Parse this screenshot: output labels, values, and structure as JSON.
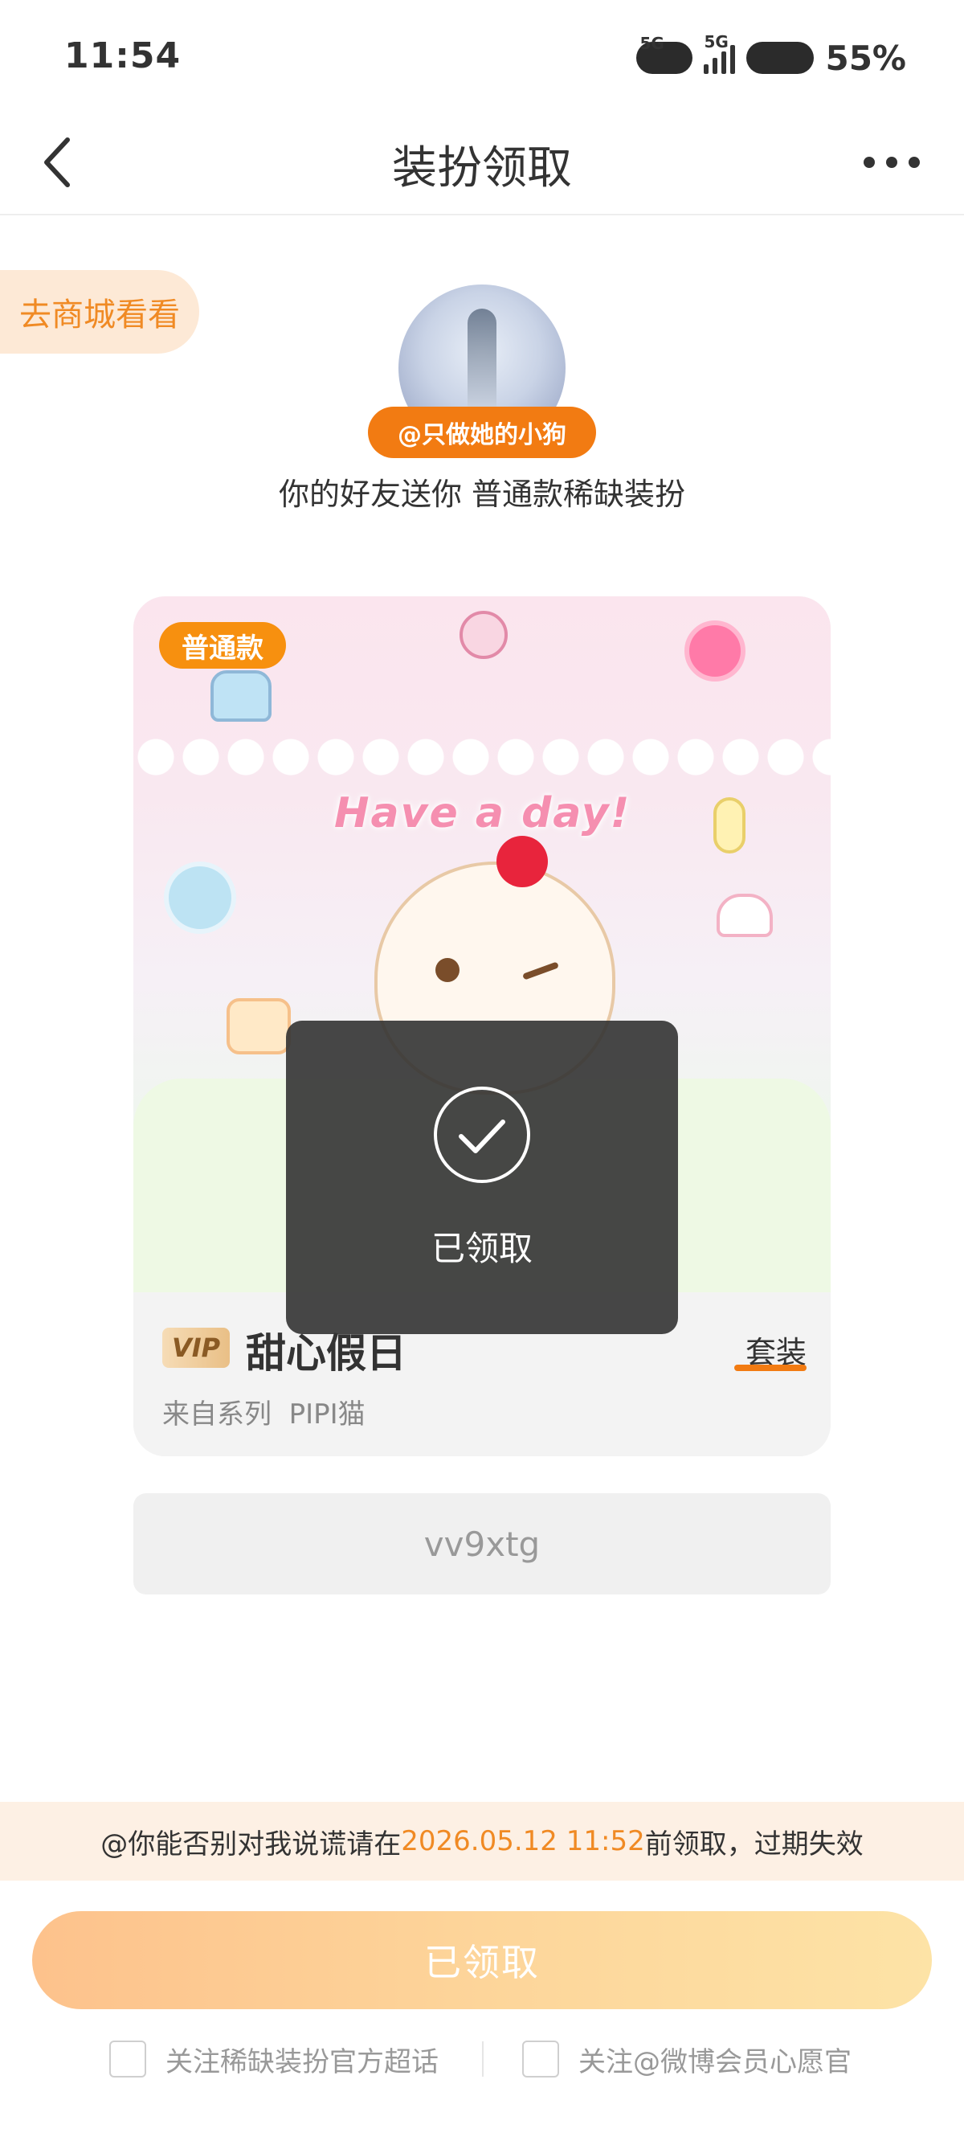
{
  "status_bar": {
    "time": "11:54",
    "net1": "5G",
    "net2": "5G",
    "battery": "55%"
  },
  "header": {
    "title": "装扮领取"
  },
  "shop_link": "去商城看看",
  "gift": {
    "username": "@只做她的小狗",
    "message_prefix": "你的好友送你 ",
    "message_item": "普通款稀缺装扮"
  },
  "card": {
    "badge": "普通款",
    "art_text": "Have a  day!",
    "vip_label": "VIP",
    "name": "甜心假日",
    "type": "套装",
    "series_label": "来自系列",
    "series_name": "PIPI猫"
  },
  "code": "vv9xtg",
  "toast": {
    "text": "已领取"
  },
  "notice": {
    "prefix": "@你能否别对我说谎请在",
    "deadline": "2026.05.12 11:52",
    "suffix": "前领取，过期失效"
  },
  "claim_button": "已领取",
  "follow": {
    "option1": "关注稀缺装扮官方超话",
    "option2": "关注@微博会员心愿官"
  },
  "colors": {
    "accent": "#f27b12",
    "notice_bg": "#fdf0e4",
    "button_start": "#fdc28c",
    "button_end": "#fde3a6"
  }
}
